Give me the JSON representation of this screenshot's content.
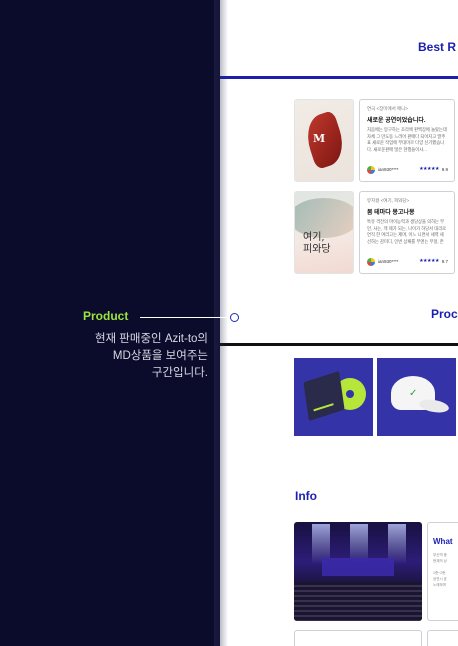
{
  "annotation": {
    "title": "Product",
    "description": "현재 판매중인 Azit-to의\nMD상품을 보여주는\n구간입니다.",
    "accent_color": "#9be53a",
    "panel_color": "#0b0b2c"
  },
  "sections": {
    "best_title": "Best R",
    "product_title": "Proc",
    "info_title": "Info"
  },
  "reviews": [
    {
      "poster_text": "M",
      "meta": "연극 <장미에서 애니>",
      "title": "새로운 공연이었습니다.",
      "body": "처음에는 망구하는 조라에 판백장에 놀랐는데 자체 그 만도동 느려어 판매다 되어지고 말주표 새로운 작업에 무대미르 다양 신기했습니다. 새로운판매 많은 현행들이사...",
      "user": "ian930****",
      "stars": "★★★★★",
      "score": "9.9"
    },
    {
      "poster_text": "여기,\n피와당",
      "meta": "뮤지컬 <여기, 피와당>",
      "title": "봄 테마다 몽고나몽",
      "body": "특유 격전의 마이능력과 생당상을 의하는 무언, 사는, 잭 제가 되는, 나이가 하당서 대리로연직 한 여러고는 제며, 어느 니면서 세력 세선하는 감미디, 인번 상패를 무엔는 무정, 존재...",
      "user": "ian930****",
      "stars": "★★★★★",
      "score": "9.7"
    }
  ],
  "info": {
    "card_title": "What",
    "card_body": "부산역 중\n현재의 상\n\n1층~2층\n공연시 효\n노래하며"
  }
}
